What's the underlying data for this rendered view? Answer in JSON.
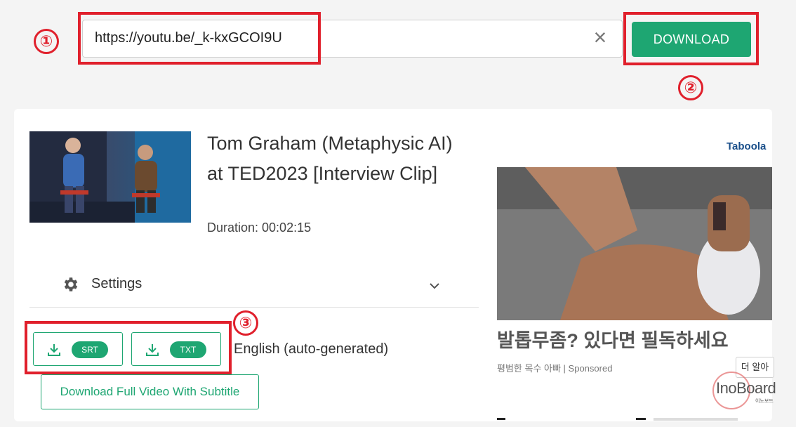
{
  "search": {
    "url": "https://youtu.be/_k-kxGCOI9U",
    "clear_icon": "×",
    "download_label": "DOWNLOAD"
  },
  "annotations": {
    "step1": "①",
    "step2": "②",
    "step3": "③",
    "color": "#e0202c"
  },
  "video": {
    "title": "Tom Graham (Metaphysic AI) at TED2023 [Interview Clip]",
    "duration": "Duration: 00:02:15"
  },
  "settings": {
    "label": "Settings",
    "icon": "gear-icon",
    "toggle_icon": "chevron-down-icon"
  },
  "subtitles": {
    "formats": [
      {
        "label": "SRT",
        "icon": "download-icon"
      },
      {
        "label": "TXT",
        "icon": "download-icon"
      }
    ],
    "language": "English (auto-generated)",
    "full_video_label": "Download Full Video With Subtitle"
  },
  "ad": {
    "provider": "Taboola",
    "headline": "발톱무좀? 있다면 필독하세요",
    "source": "평범한 목수 아빠 | Sponsored",
    "more_label": "더 알아"
  },
  "watermark": {
    "brand": "InoBoard",
    "sub": "이노보드"
  },
  "colors": {
    "accent": "#1ea672",
    "background": "#f4f4f4"
  }
}
